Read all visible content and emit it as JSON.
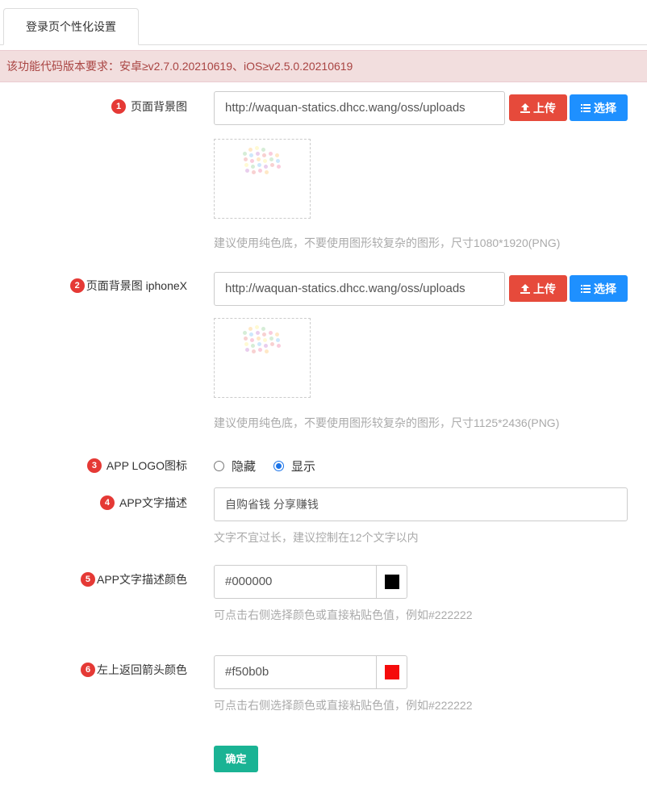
{
  "tabs": [
    {
      "label": "登录页个性化设置"
    }
  ],
  "notice": "该功能代码版本要求：安卓≥v2.7.0.20210619、iOS≥v2.5.0.20210619",
  "fields": {
    "bg": {
      "badge": "1",
      "label": "页面背景图",
      "value": "http://waquan-statics.dhcc.wang/oss/uploads",
      "upload_label": "上传",
      "select_label": "选择",
      "help": "建议使用纯色底，不要使用图形较复杂的图形，尺寸1080*1920(PNG)"
    },
    "bg_x": {
      "badge": "2",
      "label": "页面背景图 iphoneX",
      "value": "http://waquan-statics.dhcc.wang/oss/uploads",
      "upload_label": "上传",
      "select_label": "选择",
      "help": "建议使用纯色底，不要使用图形较复杂的图形，尺寸1125*2436(PNG)"
    },
    "logo": {
      "badge": "3",
      "label": "APP LOGO图标",
      "options": [
        {
          "label": "隐藏",
          "checked": false
        },
        {
          "label": "显示",
          "checked": true
        }
      ]
    },
    "desc": {
      "badge": "4",
      "label": "APP文字描述",
      "value": "自购省钱 分享赚钱",
      "help": "文字不宜过长，建议控制在12个文字以内"
    },
    "desc_color": {
      "badge": "5",
      "label": "APP文字描述颜色",
      "value": "#000000",
      "swatch": "#000000",
      "help": "可点击右侧选择颜色或直接粘贴色值，例如#222222"
    },
    "arrow_color": {
      "badge": "6",
      "label": "左上返回箭头颜色",
      "value": "#f50b0b",
      "swatch": "#f50b0b",
      "help": "可点击右侧选择颜色或直接粘贴色值，例如#222222"
    }
  },
  "submit_label": "确定",
  "colors": {
    "danger": "#e64a3b",
    "primary": "#1e90ff",
    "success": "#1ab394",
    "badge": "#e53935"
  }
}
